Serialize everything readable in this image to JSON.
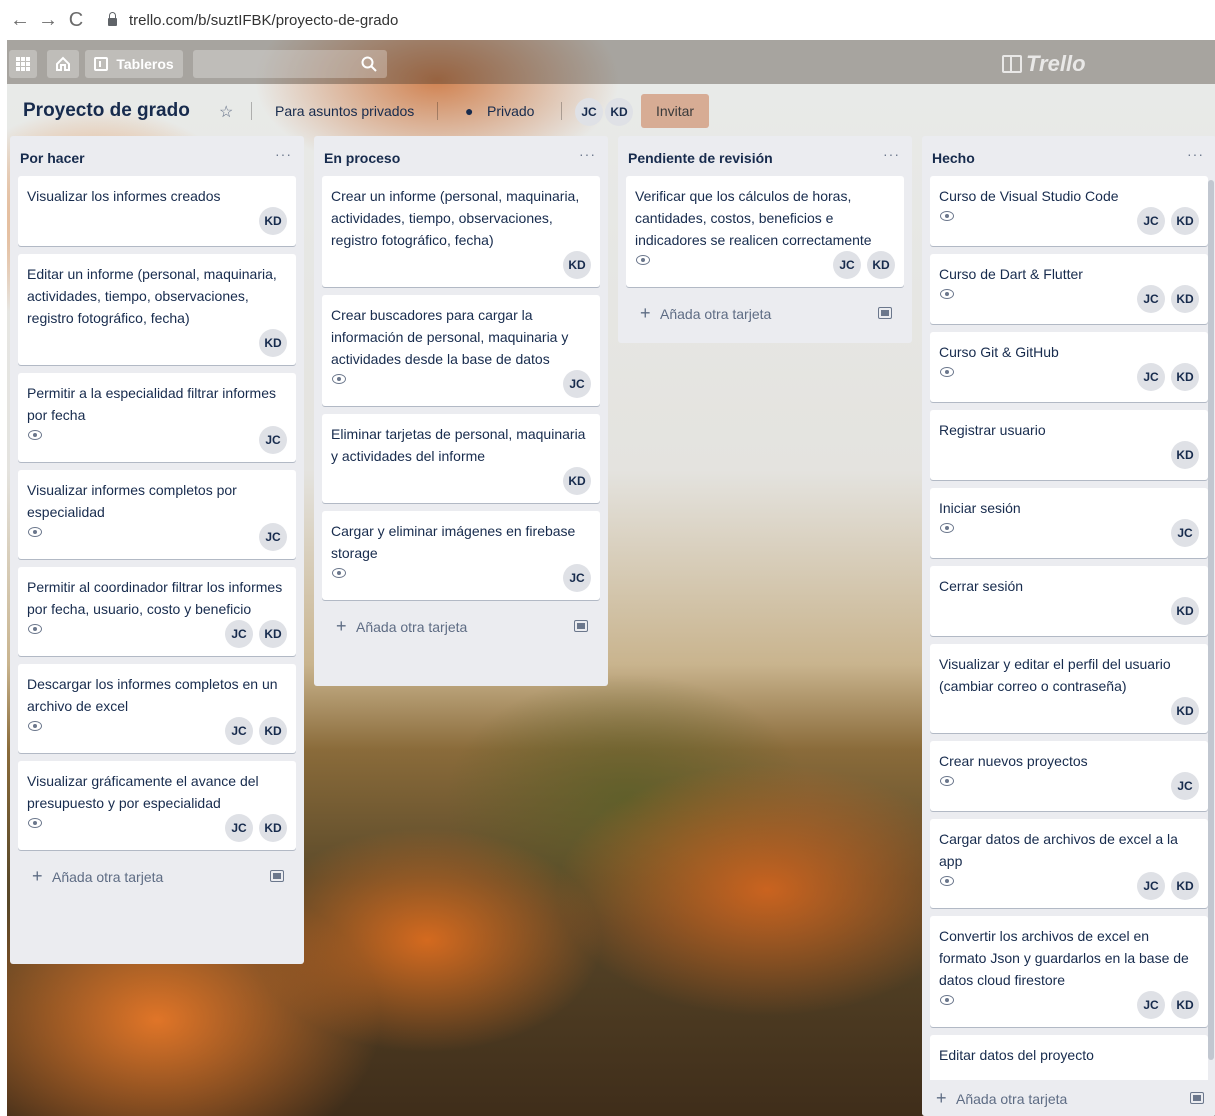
{
  "browser": {
    "back": "←",
    "forward": "→",
    "reload": "C",
    "url": "trello.com/b/suztIFBK/proyecto-de-grado"
  },
  "topnav": {
    "apps_icon": "grid-icon",
    "home_icon": "home-icon",
    "boards_label": "Tableros",
    "search_icon": "search-icon",
    "logo_text": "Trello"
  },
  "header": {
    "title": "Proyecto de grado",
    "workspace": "Para asuntos privados",
    "visibility": "Privado",
    "members": [
      "JC",
      "KD"
    ],
    "invite": "Invitar"
  },
  "lists": [
    {
      "title": "Por hacer",
      "menu": "···",
      "add": "Añada otra tarjeta",
      "cards": [
        {
          "text": "Visualizar los informes creados",
          "watch": false,
          "members": [
            "KD"
          ]
        },
        {
          "text": "Editar un informe (personal, maquinaria, actividades, tiempo, observaciones, registro fotográfico, fecha)",
          "watch": false,
          "members": [
            "KD"
          ]
        },
        {
          "text": "Permitir a la especialidad filtrar informes por fecha",
          "watch": true,
          "members": [
            "JC"
          ]
        },
        {
          "text": "Visualizar informes completos por especialidad",
          "watch": true,
          "members": [
            "JC"
          ]
        },
        {
          "text": "Permitir al coordinador filtrar los informes por fecha, usuario, costo y beneficio",
          "watch": true,
          "members": [
            "JC",
            "KD"
          ]
        },
        {
          "text": "Descargar los informes completos en un archivo de excel",
          "watch": true,
          "members": [
            "JC",
            "KD"
          ]
        },
        {
          "text": "Visualizar gráficamente el avance del presupuesto y por especialidad",
          "watch": true,
          "members": [
            "JC",
            "KD"
          ]
        }
      ]
    },
    {
      "title": "En proceso",
      "menu": "···",
      "add": "Añada otra tarjeta",
      "cards": [
        {
          "text": "Crear un informe (personal, maquinaria, actividades, tiempo, observaciones, registro fotográfico, fecha)",
          "watch": false,
          "members": [
            "KD"
          ]
        },
        {
          "text": "Crear buscadores para cargar la información de personal, maquinaria y actividades desde la base de datos",
          "watch": true,
          "members": [
            "JC"
          ]
        },
        {
          "text": "Eliminar tarjetas de personal, maquinaria y actividades del informe",
          "watch": false,
          "members": [
            "KD"
          ]
        },
        {
          "text": "Cargar y eliminar imágenes en firebase storage",
          "watch": true,
          "members": [
            "JC"
          ]
        }
      ]
    },
    {
      "title": "Pendiente de revisión",
      "menu": "···",
      "add": "Añada otra tarjeta",
      "cards": [
        {
          "text": "Verificar que los cálculos de horas, cantidades, costos, beneficios e indicadores se realicen correctamente",
          "watch": true,
          "members": [
            "JC",
            "KD"
          ]
        }
      ]
    },
    {
      "title": "Hecho",
      "menu": "···",
      "add": "Añada otra tarjeta",
      "cards": [
        {
          "text": "Curso de Visual Studio Code",
          "watch": true,
          "members": [
            "JC",
            "KD"
          ]
        },
        {
          "text": "Curso de Dart & Flutter",
          "watch": true,
          "members": [
            "JC",
            "KD"
          ]
        },
        {
          "text": "Curso Git & GitHub",
          "watch": true,
          "members": [
            "JC",
            "KD"
          ]
        },
        {
          "text": "Registrar usuario",
          "watch": false,
          "members": [
            "KD"
          ]
        },
        {
          "text": "Iniciar sesión",
          "watch": true,
          "members": [
            "JC"
          ]
        },
        {
          "text": "Cerrar sesión",
          "watch": false,
          "members": [
            "KD"
          ]
        },
        {
          "text": "Visualizar y editar el perfil del usuario (cambiar correo o contraseña)",
          "watch": false,
          "members": [
            "KD"
          ]
        },
        {
          "text": "Crear nuevos proyectos",
          "watch": true,
          "members": [
            "JC"
          ]
        },
        {
          "text": "Cargar datos de archivos de excel a la app",
          "watch": true,
          "members": [
            "JC",
            "KD"
          ]
        },
        {
          "text": "Convertir los archivos de excel en formato Json y guardarlos en la base de datos cloud firestore",
          "watch": true,
          "members": [
            "JC",
            "KD"
          ]
        },
        {
          "text": "Editar datos del proyecto",
          "watch": false,
          "members": []
        }
      ]
    }
  ]
}
